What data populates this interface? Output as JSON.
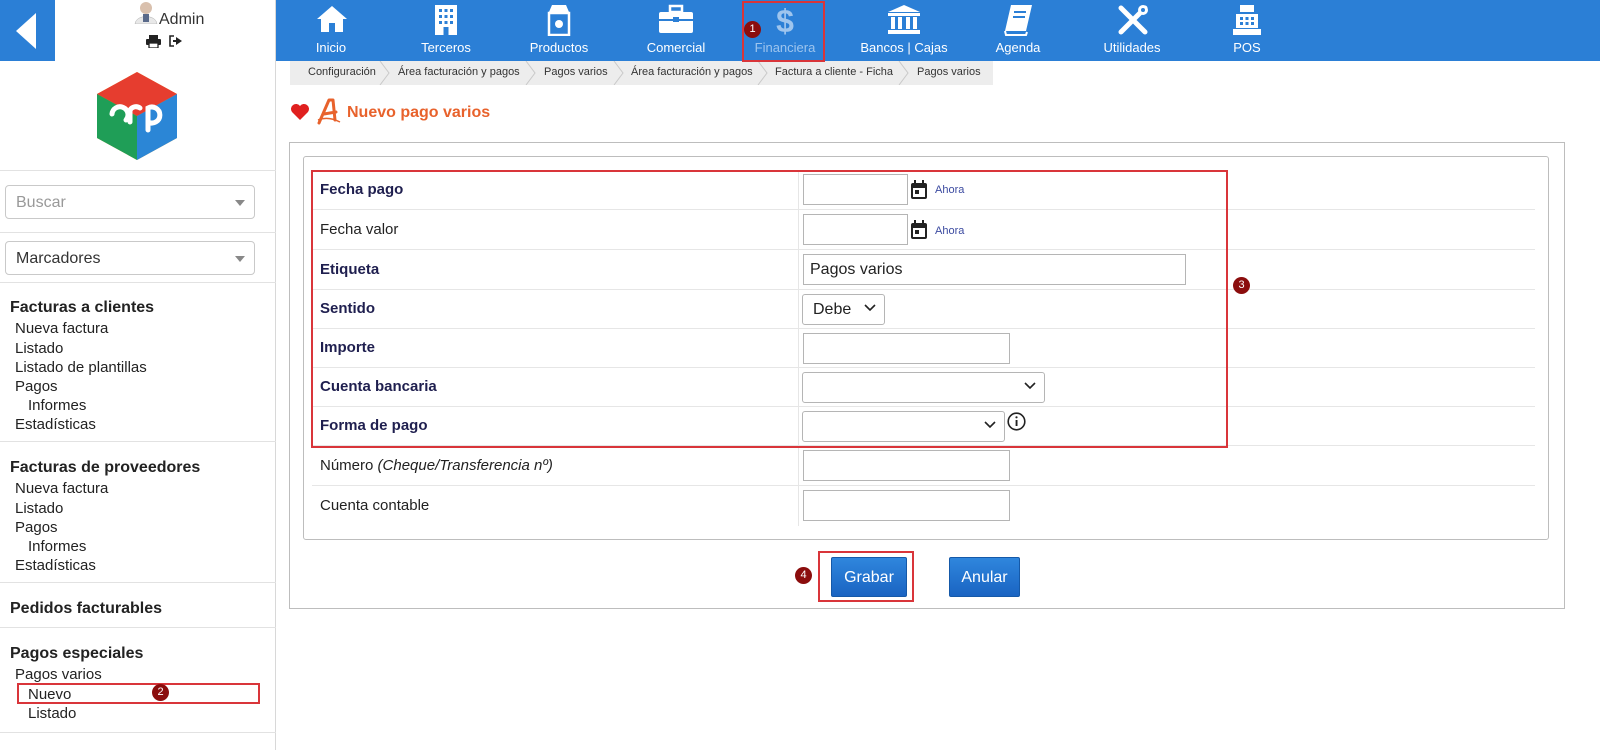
{
  "user": {
    "name": "Admin"
  },
  "search": {
    "placeholder": "Buscar"
  },
  "bookmarks": {
    "label": "Marcadores"
  },
  "nav": [
    {
      "label": "Inicio",
      "icon": "home-icon"
    },
    {
      "label": "Terceros",
      "icon": "building-icon"
    },
    {
      "label": "Productos",
      "icon": "box-icon"
    },
    {
      "label": "Comercial",
      "icon": "briefcase-icon"
    },
    {
      "label": "Financiera",
      "icon": "dollar-icon",
      "active": true
    },
    {
      "label": "Bancos | Cajas",
      "icon": "bank-icon"
    },
    {
      "label": "Agenda",
      "icon": "book-icon"
    },
    {
      "label": "Utilidades",
      "icon": "tools-icon"
    },
    {
      "label": "POS",
      "icon": "register-icon"
    }
  ],
  "breadcrumb": [
    "Configuración",
    "Área facturación y pagos",
    "Pagos varios",
    "Área facturación y pagos",
    "Factura a cliente - Ficha",
    "Pagos varios"
  ],
  "page": {
    "title": "Nuevo pago varios"
  },
  "sidebar": {
    "sections": [
      {
        "title": "Facturas a clientes",
        "items": [
          {
            "label": "Nueva factura"
          },
          {
            "label": "Listado"
          },
          {
            "label": "Listado de plantillas"
          },
          {
            "label": "Pagos"
          },
          {
            "label": "Informes"
          },
          {
            "label": "Estadísticas"
          }
        ]
      },
      {
        "title": "Facturas de proveedores",
        "items": [
          {
            "label": "Nueva factura"
          },
          {
            "label": "Listado"
          },
          {
            "label": "Pagos"
          },
          {
            "label": "Informes"
          },
          {
            "label": "Estadísticas"
          }
        ]
      },
      {
        "title": "Pedidos facturables",
        "items": []
      },
      {
        "title": "Pagos especiales",
        "items": [
          {
            "label": "Pagos varios"
          },
          {
            "label": "Nuevo"
          },
          {
            "label": "Listado"
          }
        ]
      }
    ]
  },
  "form": {
    "fecha_pago": {
      "label": "Fecha pago",
      "value": "",
      "now_label": "Ahora"
    },
    "fecha_valor": {
      "label": "Fecha valor",
      "value": "",
      "now_label": "Ahora"
    },
    "etiqueta": {
      "label": "Etiqueta",
      "value": "Pagos varios"
    },
    "sentido": {
      "label": "Sentido",
      "value": "Debe"
    },
    "importe": {
      "label": "Importe",
      "value": ""
    },
    "cuenta_bancaria": {
      "label": "Cuenta bancaria",
      "value": ""
    },
    "forma_pago": {
      "label": "Forma de pago",
      "value": ""
    },
    "numero": {
      "label": "Número",
      "hint": "(Cheque/Transferencia nº)",
      "value": ""
    },
    "cuenta_contable": {
      "label": "Cuenta contable",
      "value": ""
    }
  },
  "buttons": {
    "save": "Grabar",
    "cancel": "Anular"
  },
  "annotations": [
    "1",
    "2",
    "3",
    "4"
  ],
  "colors": {
    "topbar": "#2b7fd6",
    "title": "#e8622c",
    "annotation": "#d9353a",
    "badge": "#8b0d0d"
  }
}
